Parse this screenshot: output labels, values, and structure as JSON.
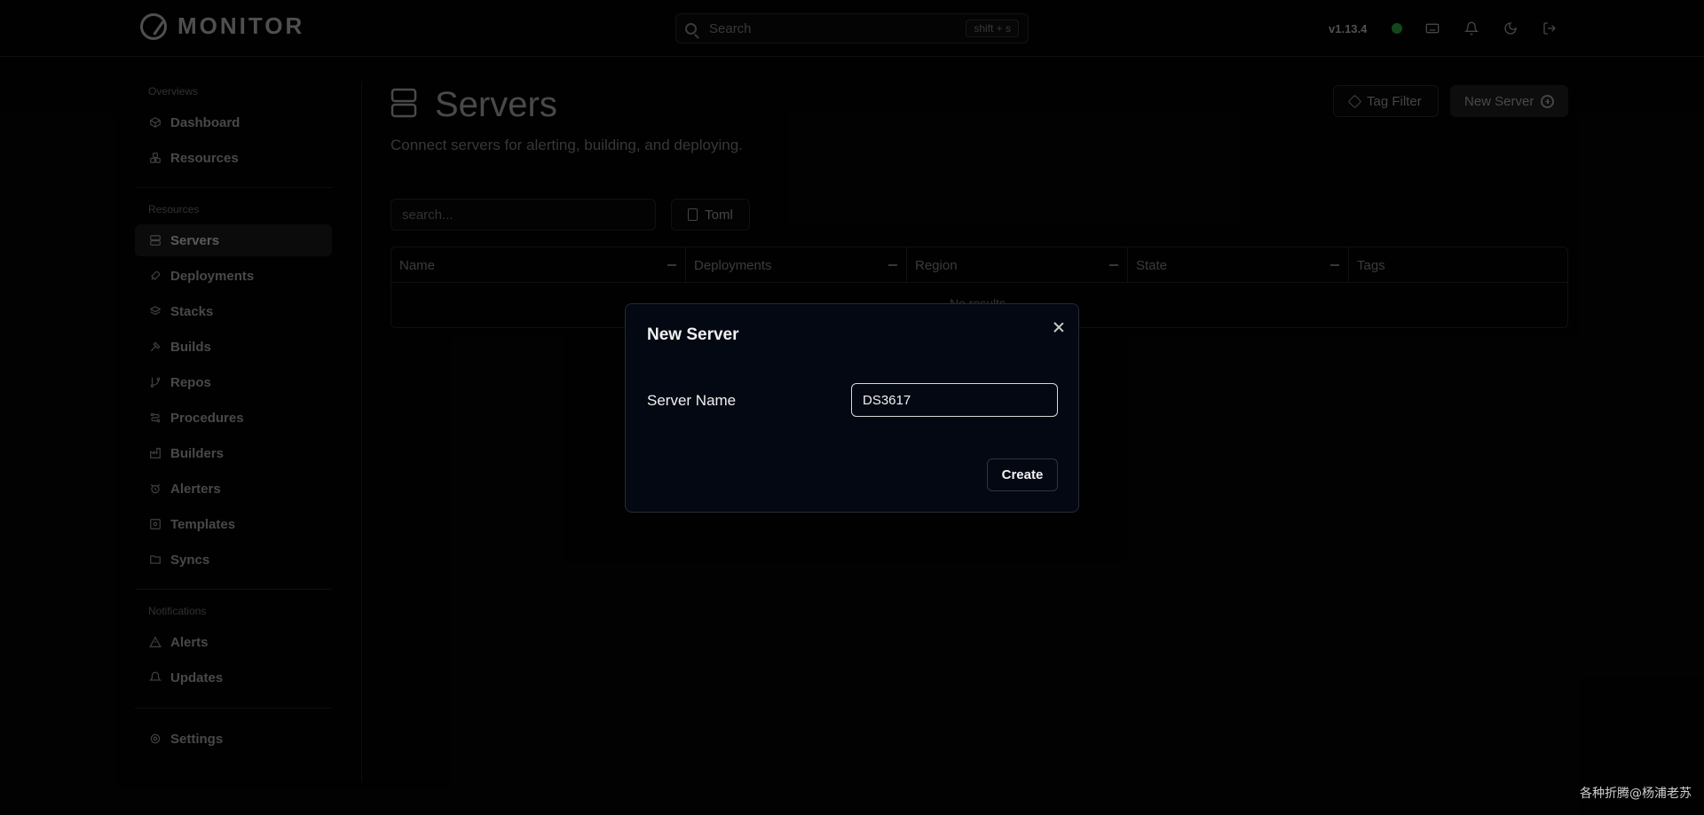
{
  "app": {
    "brand": "MONITOR",
    "version": "v1.13.4"
  },
  "search": {
    "placeholder": "Search",
    "shortcut": "shift + s"
  },
  "sidebar": {
    "sections": [
      "Overviews",
      "Resources",
      "Notifications"
    ],
    "overview_items": [
      {
        "label": "Dashboard",
        "icon": "box-icon"
      },
      {
        "label": "Resources",
        "icon": "boxes-icon"
      }
    ],
    "resource_items": [
      {
        "label": "Servers",
        "icon": "server-icon",
        "active": true
      },
      {
        "label": "Deployments",
        "icon": "rocket-icon"
      },
      {
        "label": "Stacks",
        "icon": "layers-icon"
      },
      {
        "label": "Builds",
        "icon": "hammer-icon"
      },
      {
        "label": "Repos",
        "icon": "git-branch-icon"
      },
      {
        "label": "Procedures",
        "icon": "route-icon"
      },
      {
        "label": "Builders",
        "icon": "factory-icon"
      },
      {
        "label": "Alerters",
        "icon": "alarm-clock-icon"
      },
      {
        "label": "Templates",
        "icon": "template-icon"
      },
      {
        "label": "Syncs",
        "icon": "folder-sync-icon"
      }
    ],
    "notification_items": [
      {
        "label": "Alerts",
        "icon": "warning-icon"
      },
      {
        "label": "Updates",
        "icon": "bell-icon"
      }
    ],
    "settings": {
      "label": "Settings",
      "icon": "gear-icon"
    }
  },
  "page": {
    "title": "Servers",
    "subtitle": "Connect servers for alerting, building, and deploying.",
    "tag_filter_label": "Tag Filter",
    "new_server_label": "New Server",
    "filter_placeholder": "search...",
    "toml_label": "Toml"
  },
  "table": {
    "columns": [
      "Name",
      "Deployments",
      "Region",
      "State",
      "Tags"
    ],
    "empty_text": "No results."
  },
  "modal": {
    "title": "New Server",
    "field_label": "Server Name",
    "field_value": "DS3617",
    "create_label": "Create"
  },
  "watermark": "各种折腾@杨浦老苏",
  "colors": {
    "status_ok": "#1c6d2c",
    "modal_bg": "#030812"
  }
}
